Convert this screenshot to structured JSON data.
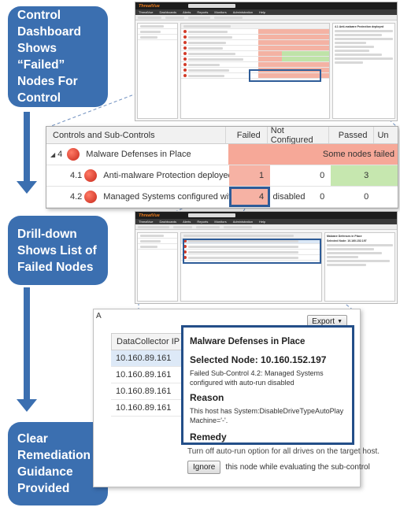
{
  "callouts": {
    "c1": [
      "Control",
      "Dashboard",
      "Shows “Failed”",
      "Nodes For",
      "Control"
    ],
    "c2": [
      "Drill-down",
      "Shows List of",
      "Failed Nodes"
    ],
    "c3": [
      "Clear",
      "Remediation",
      "Guidance",
      "Provided"
    ]
  },
  "colors": {
    "callout": "#3b6fb0",
    "failed_bg": "#f4b2a3",
    "passed_bg": "#bfe3a8",
    "highlight": "#2e5c98"
  },
  "mini1": {
    "brand": "ThreatVue",
    "nav": [
      "ThreatVue",
      "Dashboards",
      "Alerts",
      "Reports",
      "Monitors",
      "Administration",
      "Help"
    ],
    "right_title": "4.1 Anti-malware Protection deployed"
  },
  "mini2": {
    "brand": "ThreatVue",
    "nav": [
      "ThreatVue",
      "Dashboards",
      "Alerts",
      "Reports",
      "Monitors",
      "Administration",
      "Help"
    ],
    "right_title": "Malware Defenses in Place",
    "right_node": "Selected Node: 10.160.152.197"
  },
  "controls_table": {
    "headers": [
      "Controls and Sub-Controls",
      "Failed",
      "Not Configured",
      "Passed",
      "Un"
    ],
    "group_row": {
      "number": "4",
      "label": "Malware Defenses in Place",
      "status": "Some nodes failed"
    },
    "rows": [
      {
        "label": "4.1",
        "text": "Anti-malware Protection deployed",
        "failed": "1",
        "not_configured": "0",
        "passed": "3",
        "unknown": ""
      },
      {
        "label": "4.2",
        "text": "Managed Systems configured with auto-run disabled",
        "failed": "4",
        "not_configured": "0",
        "passed": "0",
        "unknown": ""
      }
    ]
  },
  "detail": {
    "panel_letter": "A",
    "export_label": "Export",
    "column_header": "DataCollector IP",
    "ips": [
      "10.160.89.161",
      "10.160.89.161",
      "10.160.89.161",
      "10.160.89.161"
    ],
    "popup_title": "Malware Defenses in Place",
    "selected_node": "Selected Node: 10.160.152.197",
    "failed_text": "Failed Sub-Control 4.2: Managed Systems configured with auto-run disabled",
    "reason_label": "Reason",
    "reason_text": "This host has System:DisableDriveTypeAutoPlayMachine='-'.",
    "remedy_label": "Remedy",
    "remedy_text": "Turn off auto-run option for all drives on the target host.",
    "ignore_label": "Ignore",
    "ignore_text": "this node while evaluating the sub-control"
  }
}
